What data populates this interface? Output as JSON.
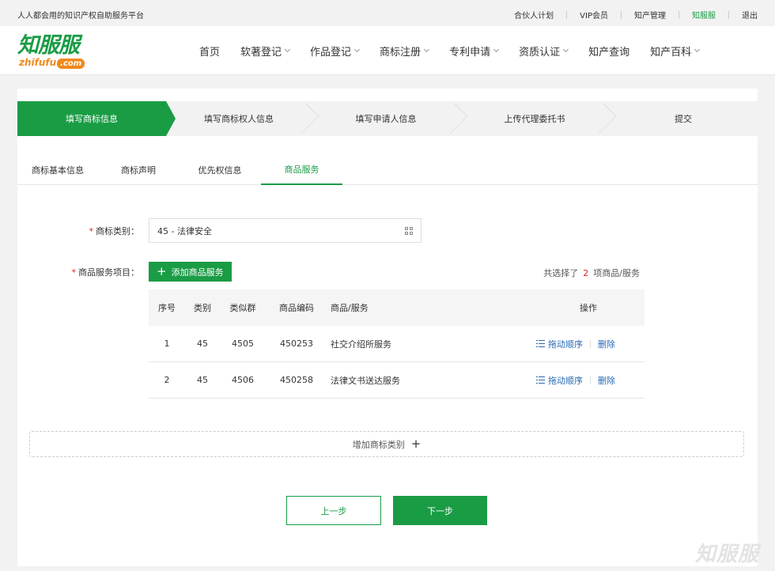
{
  "topbar": {
    "slogan": "人人都会用的知识产权自助服务平台",
    "links": [
      "合伙人计划",
      "VIP会员",
      "知产管理",
      "知服服",
      "退出"
    ]
  },
  "logo": {
    "cn": "知服服",
    "en": "zhifufu",
    "en_suffix": ".com"
  },
  "nav": {
    "items": [
      {
        "label": "首页"
      },
      {
        "label": "软著登记"
      },
      {
        "label": "作品登记"
      },
      {
        "label": "商标注册"
      },
      {
        "label": "专利申请"
      },
      {
        "label": "资质认证"
      },
      {
        "label": "知产查询"
      },
      {
        "label": "知产百科"
      }
    ]
  },
  "steps": [
    "填写商标信息",
    "填写商标权人信息",
    "填写申请人信息",
    "上传代理委托书",
    "提交"
  ],
  "tabs": [
    "商标基本信息",
    "商标声明",
    "优先权信息",
    "商品服务"
  ],
  "form": {
    "class_label": "商标类别：",
    "class_value": "45 - 法律安全",
    "items_label": "商品服务项目：",
    "add_button": "添加商品服务",
    "count_prefix": "共选择了",
    "count_value": "2",
    "count_suffix": "项商品/服务"
  },
  "table": {
    "headers": [
      "序号",
      "类别",
      "类似群",
      "商品编码",
      "商品/服务",
      "操作"
    ],
    "rows": [
      {
        "no": "1",
        "cls": "45",
        "group": "4505",
        "code": "450253",
        "name": "社交介绍所服务"
      },
      {
        "no": "2",
        "cls": "45",
        "group": "4506",
        "code": "450258",
        "name": "法律文书送达服务"
      }
    ],
    "drag_label": "拖动顺序",
    "delete_label": "删除"
  },
  "add_class_label": "增加商标类别",
  "buttons": {
    "prev": "上一步",
    "next": "下一步"
  },
  "watermark": "知服服",
  "colors": {
    "brand": "#1a9c45",
    "required": "#e02020",
    "link": "#2a6ab3",
    "logo_orange": "#f08a1c"
  }
}
